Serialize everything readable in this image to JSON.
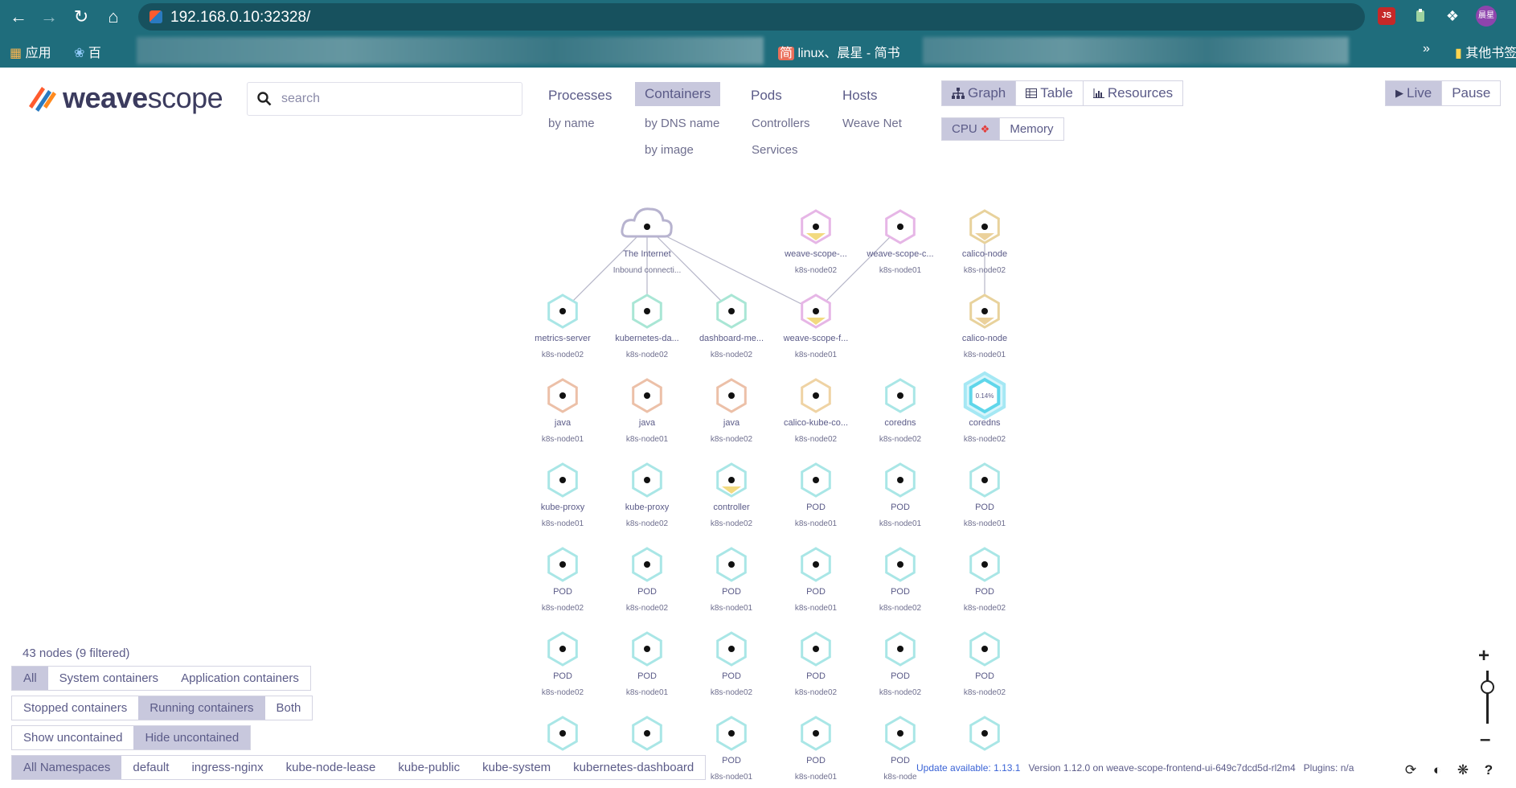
{
  "browser": {
    "url": "192.168.0.10:32328/",
    "ext_badge": "JS",
    "profile_label": "晨星",
    "bookmarks": {
      "apps": "应用",
      "baidu": "百",
      "jianshu_icon": "简",
      "jianshu": "linux、晨星 - 简书",
      "more": "»",
      "other": "其他书签"
    }
  },
  "app": {
    "logo_bold": "weave",
    "logo_light": "scope",
    "search_placeholder": "search",
    "topologies": [
      {
        "label": "Processes",
        "subs": [
          "by name"
        ]
      },
      {
        "label": "Containers",
        "subs": [
          "by DNS name",
          "by image"
        ]
      },
      {
        "label": "Pods",
        "subs": [
          "Controllers",
          "Services"
        ]
      },
      {
        "label": "Hosts",
        "subs": [
          "Weave Net"
        ]
      }
    ],
    "view_modes": [
      "Graph",
      "Table",
      "Resources"
    ],
    "metrics": [
      "CPU",
      "Memory"
    ],
    "live_controls": [
      "Live",
      "Pause"
    ]
  },
  "graph": {
    "nodes": [
      {
        "label": "The Internet",
        "sub": "Inbound connecti...",
        "shape": "cloud",
        "color": "#b7b3cf"
      },
      {
        "label": "weave-scope-...",
        "sub": "k8s-node02",
        "color": "#e6b6e6",
        "fill": "#f0d36a"
      },
      {
        "label": "weave-scope-c...",
        "sub": "k8s-node01",
        "color": "#e6b6e6"
      },
      {
        "label": "calico-node",
        "sub": "k8s-node02",
        "color": "#e8d29c",
        "fill": "#e8c98a"
      },
      {
        "label": "metrics-server",
        "sub": "k8s-node02",
        "color": "#a9e6e6"
      },
      {
        "label": "kubernetes-da...",
        "sub": "k8s-node02",
        "color": "#a9e6d5"
      },
      {
        "label": "dashboard-me...",
        "sub": "k8s-node02",
        "color": "#a9e6d5"
      },
      {
        "label": "weave-scope-f...",
        "sub": "k8s-node01",
        "color": "#e6b6e6",
        "fill": "#f0d36a"
      },
      {
        "label": "calico-node",
        "sub": "k8s-node01",
        "color": "#e8d29c",
        "fill": "#e8c98a"
      },
      {
        "label": "java",
        "sub": "k8s-node01",
        "color": "#ecc0a8"
      },
      {
        "label": "java",
        "sub": "k8s-node01",
        "color": "#ecc0a8"
      },
      {
        "label": "java",
        "sub": "k8s-node02",
        "color": "#ecc0a8"
      },
      {
        "label": "calico-kube-co...",
        "sub": "k8s-node02",
        "color": "#efd3a4"
      },
      {
        "label": "coredns",
        "sub": "k8s-node02",
        "color": "#a9e6e6"
      },
      {
        "label": "coredns",
        "sub": "k8s-node02",
        "color": "#5fd6ea",
        "highlight": true,
        "value": "0.14%"
      },
      {
        "label": "kube-proxy",
        "sub": "k8s-node01",
        "color": "#a9e6e6"
      },
      {
        "label": "kube-proxy",
        "sub": "k8s-node02",
        "color": "#a9e6e6"
      },
      {
        "label": "controller",
        "sub": "k8s-node02",
        "color": "#a9e6e6",
        "fill": "#f0d36a"
      },
      {
        "label": "POD",
        "sub": "k8s-node01",
        "color": "#a9e6e6"
      },
      {
        "label": "POD",
        "sub": "k8s-node01",
        "color": "#a9e6e6"
      },
      {
        "label": "POD",
        "sub": "k8s-node01",
        "color": "#a9e6e6"
      },
      {
        "label": "POD",
        "sub": "k8s-node02",
        "color": "#a9e6e6"
      },
      {
        "label": "POD",
        "sub": "k8s-node02",
        "color": "#a9e6e6"
      },
      {
        "label": "POD",
        "sub": "k8s-node01",
        "color": "#a9e6e6"
      },
      {
        "label": "POD",
        "sub": "k8s-node01",
        "color": "#a9e6e6"
      },
      {
        "label": "POD",
        "sub": "k8s-node02",
        "color": "#a9e6e6"
      },
      {
        "label": "POD",
        "sub": "k8s-node02",
        "color": "#a9e6e6"
      },
      {
        "label": "POD",
        "sub": "k8s-node02",
        "color": "#a9e6e6"
      },
      {
        "label": "POD",
        "sub": "k8s-node01",
        "color": "#a9e6e6"
      },
      {
        "label": "POD",
        "sub": "k8s-node02",
        "color": "#a9e6e6"
      },
      {
        "label": "POD",
        "sub": "k8s-node02",
        "color": "#a9e6e6"
      },
      {
        "label": "POD",
        "sub": "k8s-node02",
        "color": "#a9e6e6"
      },
      {
        "label": "POD",
        "sub": "k8s-node02",
        "color": "#a9e6e6"
      },
      {
        "label": "",
        "sub": "",
        "color": "#a9e6e6"
      },
      {
        "label": "",
        "sub": "",
        "color": "#a9e6e6"
      },
      {
        "label": "POD",
        "sub": "k8s-node01",
        "color": "#a9e6e6"
      },
      {
        "label": "POD",
        "sub": "k8s-node01",
        "color": "#a9e6e6"
      },
      {
        "label": "POD",
        "sub": "k8s-node",
        "color": "#a9e6e6"
      },
      {
        "label": "",
        "sub": "",
        "color": "#a9e6e6"
      }
    ],
    "edges": [
      [
        0,
        4
      ],
      [
        0,
        5
      ],
      [
        0,
        6
      ],
      [
        0,
        7
      ],
      [
        2,
        7
      ],
      [
        3,
        8
      ]
    ]
  },
  "filters": {
    "node_count": "43 nodes (9 filtered)",
    "container_types": [
      "All",
      "System containers",
      "Application containers"
    ],
    "container_state": [
      "Stopped containers",
      "Running containers",
      "Both"
    ],
    "uncontained": [
      "Show uncontained",
      "Hide uncontained"
    ],
    "namespaces": [
      "All Namespaces",
      "default",
      "ingress-nginx",
      "kube-node-lease",
      "kube-public",
      "kube-system",
      "kubernetes-dashboard"
    ]
  },
  "footer": {
    "update": "Update available: 1.13.1",
    "version": "Version 1.12.0 on weave-scope-frontend-ui-649c7dcd5d-rl2m4",
    "plugins": "Plugins: n/a"
  },
  "zoom": {
    "level": 0.7
  }
}
